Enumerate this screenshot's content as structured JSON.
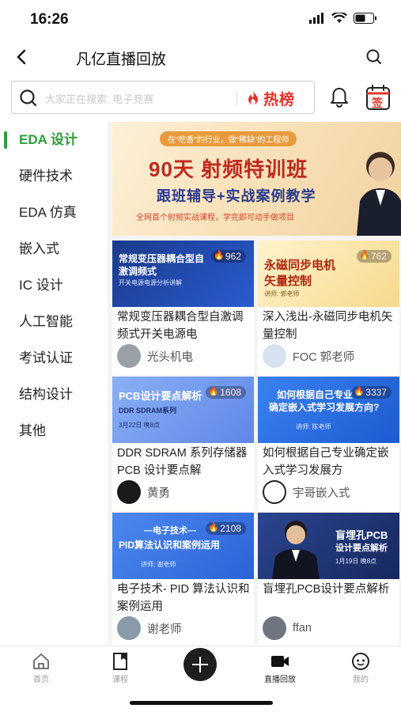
{
  "status": {
    "time": "16:26"
  },
  "nav": {
    "title": "凡亿直播回放"
  },
  "search": {
    "placeholder": "大家正在搜索: 电子竞赛",
    "hot_label": "热榜",
    "calendar_label": "签"
  },
  "sidebar": {
    "items": [
      {
        "label": "EDA 设计",
        "active": true
      },
      {
        "label": "硬件技术"
      },
      {
        "label": "EDA 仿真"
      },
      {
        "label": "嵌入式"
      },
      {
        "label": "IC 设计"
      },
      {
        "label": "人工智能"
      },
      {
        "label": "考试认证"
      },
      {
        "label": "结构设计"
      },
      {
        "label": "其他"
      }
    ]
  },
  "banner": {
    "sub": "在“吃香”的行业，做“稀缺”的工程师",
    "title": "90天 射频特训班",
    "title2": "跟班辅导+实战案例教学",
    "foot": "全网首个射频实战课程，学完即可动手做项目"
  },
  "cards": [
    {
      "thumb_line1": "常规变压器耦合型自",
      "thumb_line2": "激调频式",
      "thumb_line3": "开关电源电源分析讲解",
      "views": "962",
      "title": "常规变压器耦合型自激调频式开关电源电",
      "author": "光头机电",
      "bg": "#1b3a8a"
    },
    {
      "thumb_line1": "永磁同步电机",
      "thumb_line2": "矢量控制",
      "thumb_line3": "讲师: 郭老师",
      "views": "762",
      "title": "深入浅出-永磁同步电机矢量控制",
      "author": "FOC 郭老师",
      "bg": "#fbe7a6"
    },
    {
      "thumb_line1": "PCB设计要点解析",
      "thumb_line2": "DDR SDRAM系列",
      "thumb_line3": "3月22日 晚8点",
      "views": "1608",
      "title": "DDR SDRAM 系列存储器 PCB 设计要点解",
      "author": "黄勇",
      "bg": "#7fa3f0"
    },
    {
      "thumb_line1": "如何根据自己专业",
      "thumb_line2": "确定嵌入式学习发展方向?",
      "thumb_line3": "讲师: 陈老师",
      "views": "3337",
      "title": "如何根据自己专业确定嵌入式学习发展方",
      "author": "宇哥嵌入式",
      "bg": "#2a6fe0"
    },
    {
      "thumb_line1": "—电子技术—",
      "thumb_line2": "PID算法认识和案例运用",
      "thumb_line3": "讲师: 谢老师",
      "views": "2108",
      "title": "电子技术- PID 算法认识和案例运用",
      "author": "谢老师",
      "bg": "#3a78e8"
    },
    {
      "thumb_line1": "盲埋孔PCB",
      "thumb_line2": "设计要点解析",
      "thumb_line3": "1月19日 晚8点",
      "views": "",
      "title": "盲埋孔PCB设计要点解析",
      "author": "ffan",
      "bg": "#243a7c"
    }
  ],
  "tabs": [
    {
      "label": "首页",
      "icon": "home-icon"
    },
    {
      "label": "课程",
      "icon": "course-icon"
    },
    {
      "label": "",
      "icon": "add-icon"
    },
    {
      "label": "直播回放",
      "icon": "video-icon",
      "active": true
    },
    {
      "label": "我的",
      "icon": "profile-icon"
    }
  ]
}
